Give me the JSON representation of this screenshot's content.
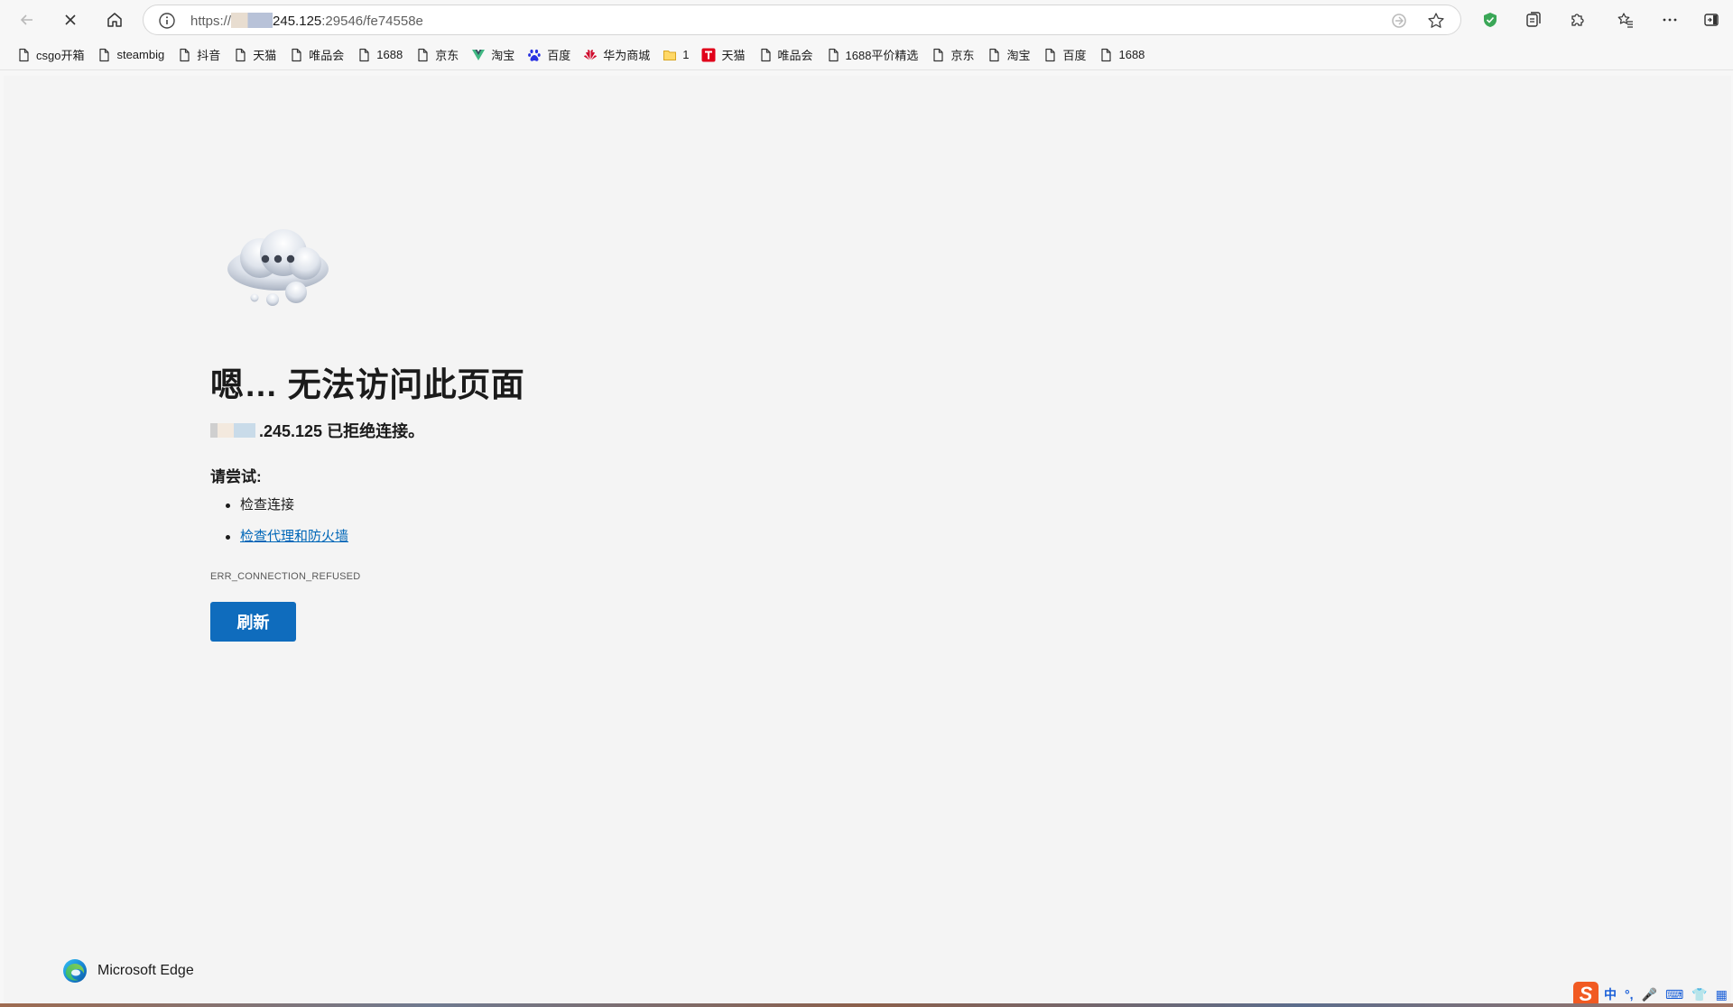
{
  "browser": {
    "address": {
      "protocol": "https://",
      "host_visible": "245.125",
      "port_path": ":29546/fe74558e"
    },
    "bookmarks": [
      {
        "label": "csgo开箱",
        "icon": "page-icon"
      },
      {
        "label": "steambig",
        "icon": "page-icon"
      },
      {
        "label": "抖音",
        "icon": "page-icon"
      },
      {
        "label": "天猫",
        "icon": "page-icon"
      },
      {
        "label": "唯品会",
        "icon": "page-icon"
      },
      {
        "label": "1688",
        "icon": "page-icon"
      },
      {
        "label": "京东",
        "icon": "page-icon"
      },
      {
        "label": "淘宝",
        "icon": "vue-logo-icon"
      },
      {
        "label": "百度",
        "icon": "baidu-paw-icon"
      },
      {
        "label": "华为商城",
        "icon": "huawei-icon"
      },
      {
        "label": "1",
        "icon": "folder-icon"
      },
      {
        "label": "天猫",
        "icon": "tmall-icon"
      },
      {
        "label": "唯品会",
        "icon": "page-icon"
      },
      {
        "label": "1688平价精选",
        "icon": "page-icon"
      },
      {
        "label": "京东",
        "icon": "page-icon"
      },
      {
        "label": "淘宝",
        "icon": "page-icon"
      },
      {
        "label": "百度",
        "icon": "page-icon"
      },
      {
        "label": "1688",
        "icon": "page-icon"
      }
    ]
  },
  "error_page": {
    "headline": "嗯… 无法访问此页面",
    "refused_text": ".245.125 已拒绝连接。",
    "try_label": "请尝试:",
    "tips": [
      "检查连接",
      "检查代理和防火墙"
    ],
    "error_code": "ERR_CONNECTION_REFUSED",
    "refresh_label": "刷新",
    "brand": "Microsoft Edge"
  },
  "ime_tray": {
    "logo": "S",
    "items": [
      "中",
      "°,",
      "🎤",
      "⌨",
      "👕",
      "▦"
    ]
  },
  "colors": {
    "accent": "#0f6cbd",
    "link": "#0067b8",
    "shield": "#3aa757",
    "ime": "#f15a22"
  }
}
